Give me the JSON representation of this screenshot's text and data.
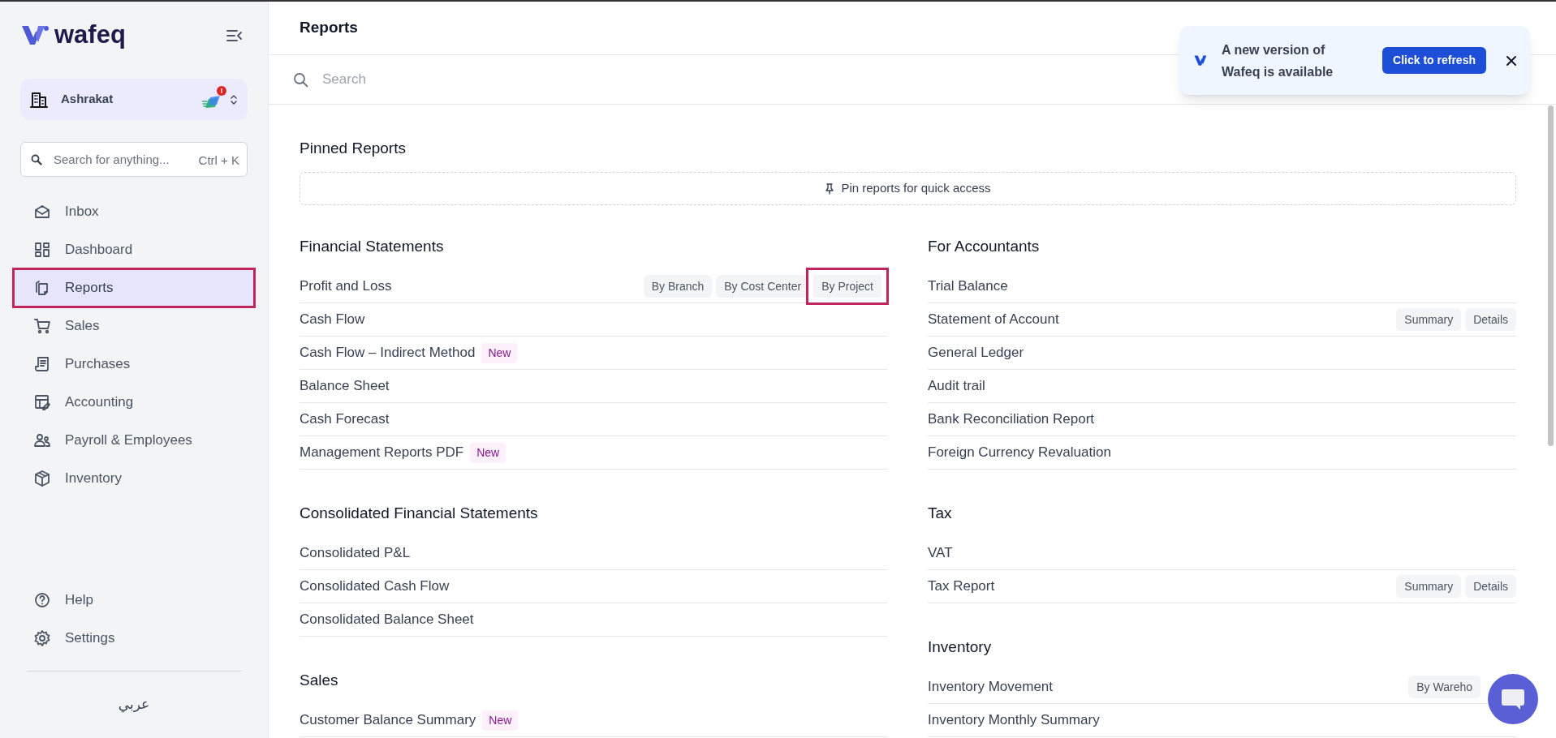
{
  "sidebar": {
    "brand": "wafeq",
    "organization": {
      "name": "Ashrakat",
      "alert": "!"
    },
    "search": {
      "placeholder": "Search for anything...",
      "shortcut": "Ctrl + K"
    },
    "nav": [
      {
        "label": "Inbox",
        "selected": false,
        "highlighted": false
      },
      {
        "label": "Dashboard",
        "selected": false,
        "highlighted": false
      },
      {
        "label": "Reports",
        "selected": true,
        "highlighted": true
      },
      {
        "label": "Sales",
        "selected": false,
        "highlighted": false
      },
      {
        "label": "Purchases",
        "selected": false,
        "highlighted": false
      },
      {
        "label": "Accounting",
        "selected": false,
        "highlighted": false
      },
      {
        "label": "Payroll & Employees",
        "selected": false,
        "highlighted": false
      },
      {
        "label": "Inventory",
        "selected": false,
        "highlighted": false
      }
    ],
    "footer_nav": [
      {
        "label": "Help"
      },
      {
        "label": "Settings"
      }
    ],
    "language": "عربي"
  },
  "header": {
    "title": "Reports"
  },
  "search": {
    "placeholder": "Search"
  },
  "pinned": {
    "title": "Pinned Reports",
    "empty_text": "Pin reports for quick access"
  },
  "columns": [
    [
      {
        "title": "Financial Statements",
        "rows": [
          {
            "label": "Profit and Loss",
            "options": [
              {
                "label": "By Branch",
                "highlighted": false
              },
              {
                "label": "By Cost Center",
                "highlighted": false
              },
              {
                "label": "By Project",
                "highlighted": true
              }
            ]
          },
          {
            "label": "Cash Flow"
          },
          {
            "label": "Cash Flow – Indirect Method",
            "badge": "New"
          },
          {
            "label": "Balance Sheet"
          },
          {
            "label": "Cash Forecast"
          },
          {
            "label": "Management Reports PDF",
            "badge": "New"
          }
        ]
      },
      {
        "title": "Consolidated Financial Statements",
        "rows": [
          {
            "label": "Consolidated P&L"
          },
          {
            "label": "Consolidated Cash Flow"
          },
          {
            "label": "Consolidated Balance Sheet"
          }
        ]
      },
      {
        "title": "Sales",
        "rows": [
          {
            "label": "Customer Balance Summary",
            "badge": "New"
          }
        ]
      }
    ],
    [
      {
        "title": "For Accountants",
        "rows": [
          {
            "label": "Trial Balance"
          },
          {
            "label": "Statement of Account",
            "options": [
              {
                "label": "Summary",
                "highlighted": false
              },
              {
                "label": "Details",
                "highlighted": false
              }
            ]
          },
          {
            "label": "General Ledger"
          },
          {
            "label": "Audit trail"
          },
          {
            "label": "Bank Reconciliation Report"
          },
          {
            "label": "Foreign Currency Revaluation"
          }
        ]
      },
      {
        "title": "Tax",
        "rows": [
          {
            "label": "VAT"
          },
          {
            "label": "Tax Report",
            "options": [
              {
                "label": "Summary",
                "highlighted": false
              },
              {
                "label": "Details",
                "highlighted": false
              }
            ]
          }
        ]
      },
      {
        "title": "Inventory",
        "rows": [
          {
            "label": "Inventory Movement",
            "options": [
              {
                "label": "By Wareho",
                "highlighted": false
              }
            ]
          },
          {
            "label": "Inventory Monthly Summary"
          }
        ]
      }
    ]
  ],
  "toast": {
    "message": "A new version of Wafeq is available",
    "action": "Click to refresh"
  }
}
